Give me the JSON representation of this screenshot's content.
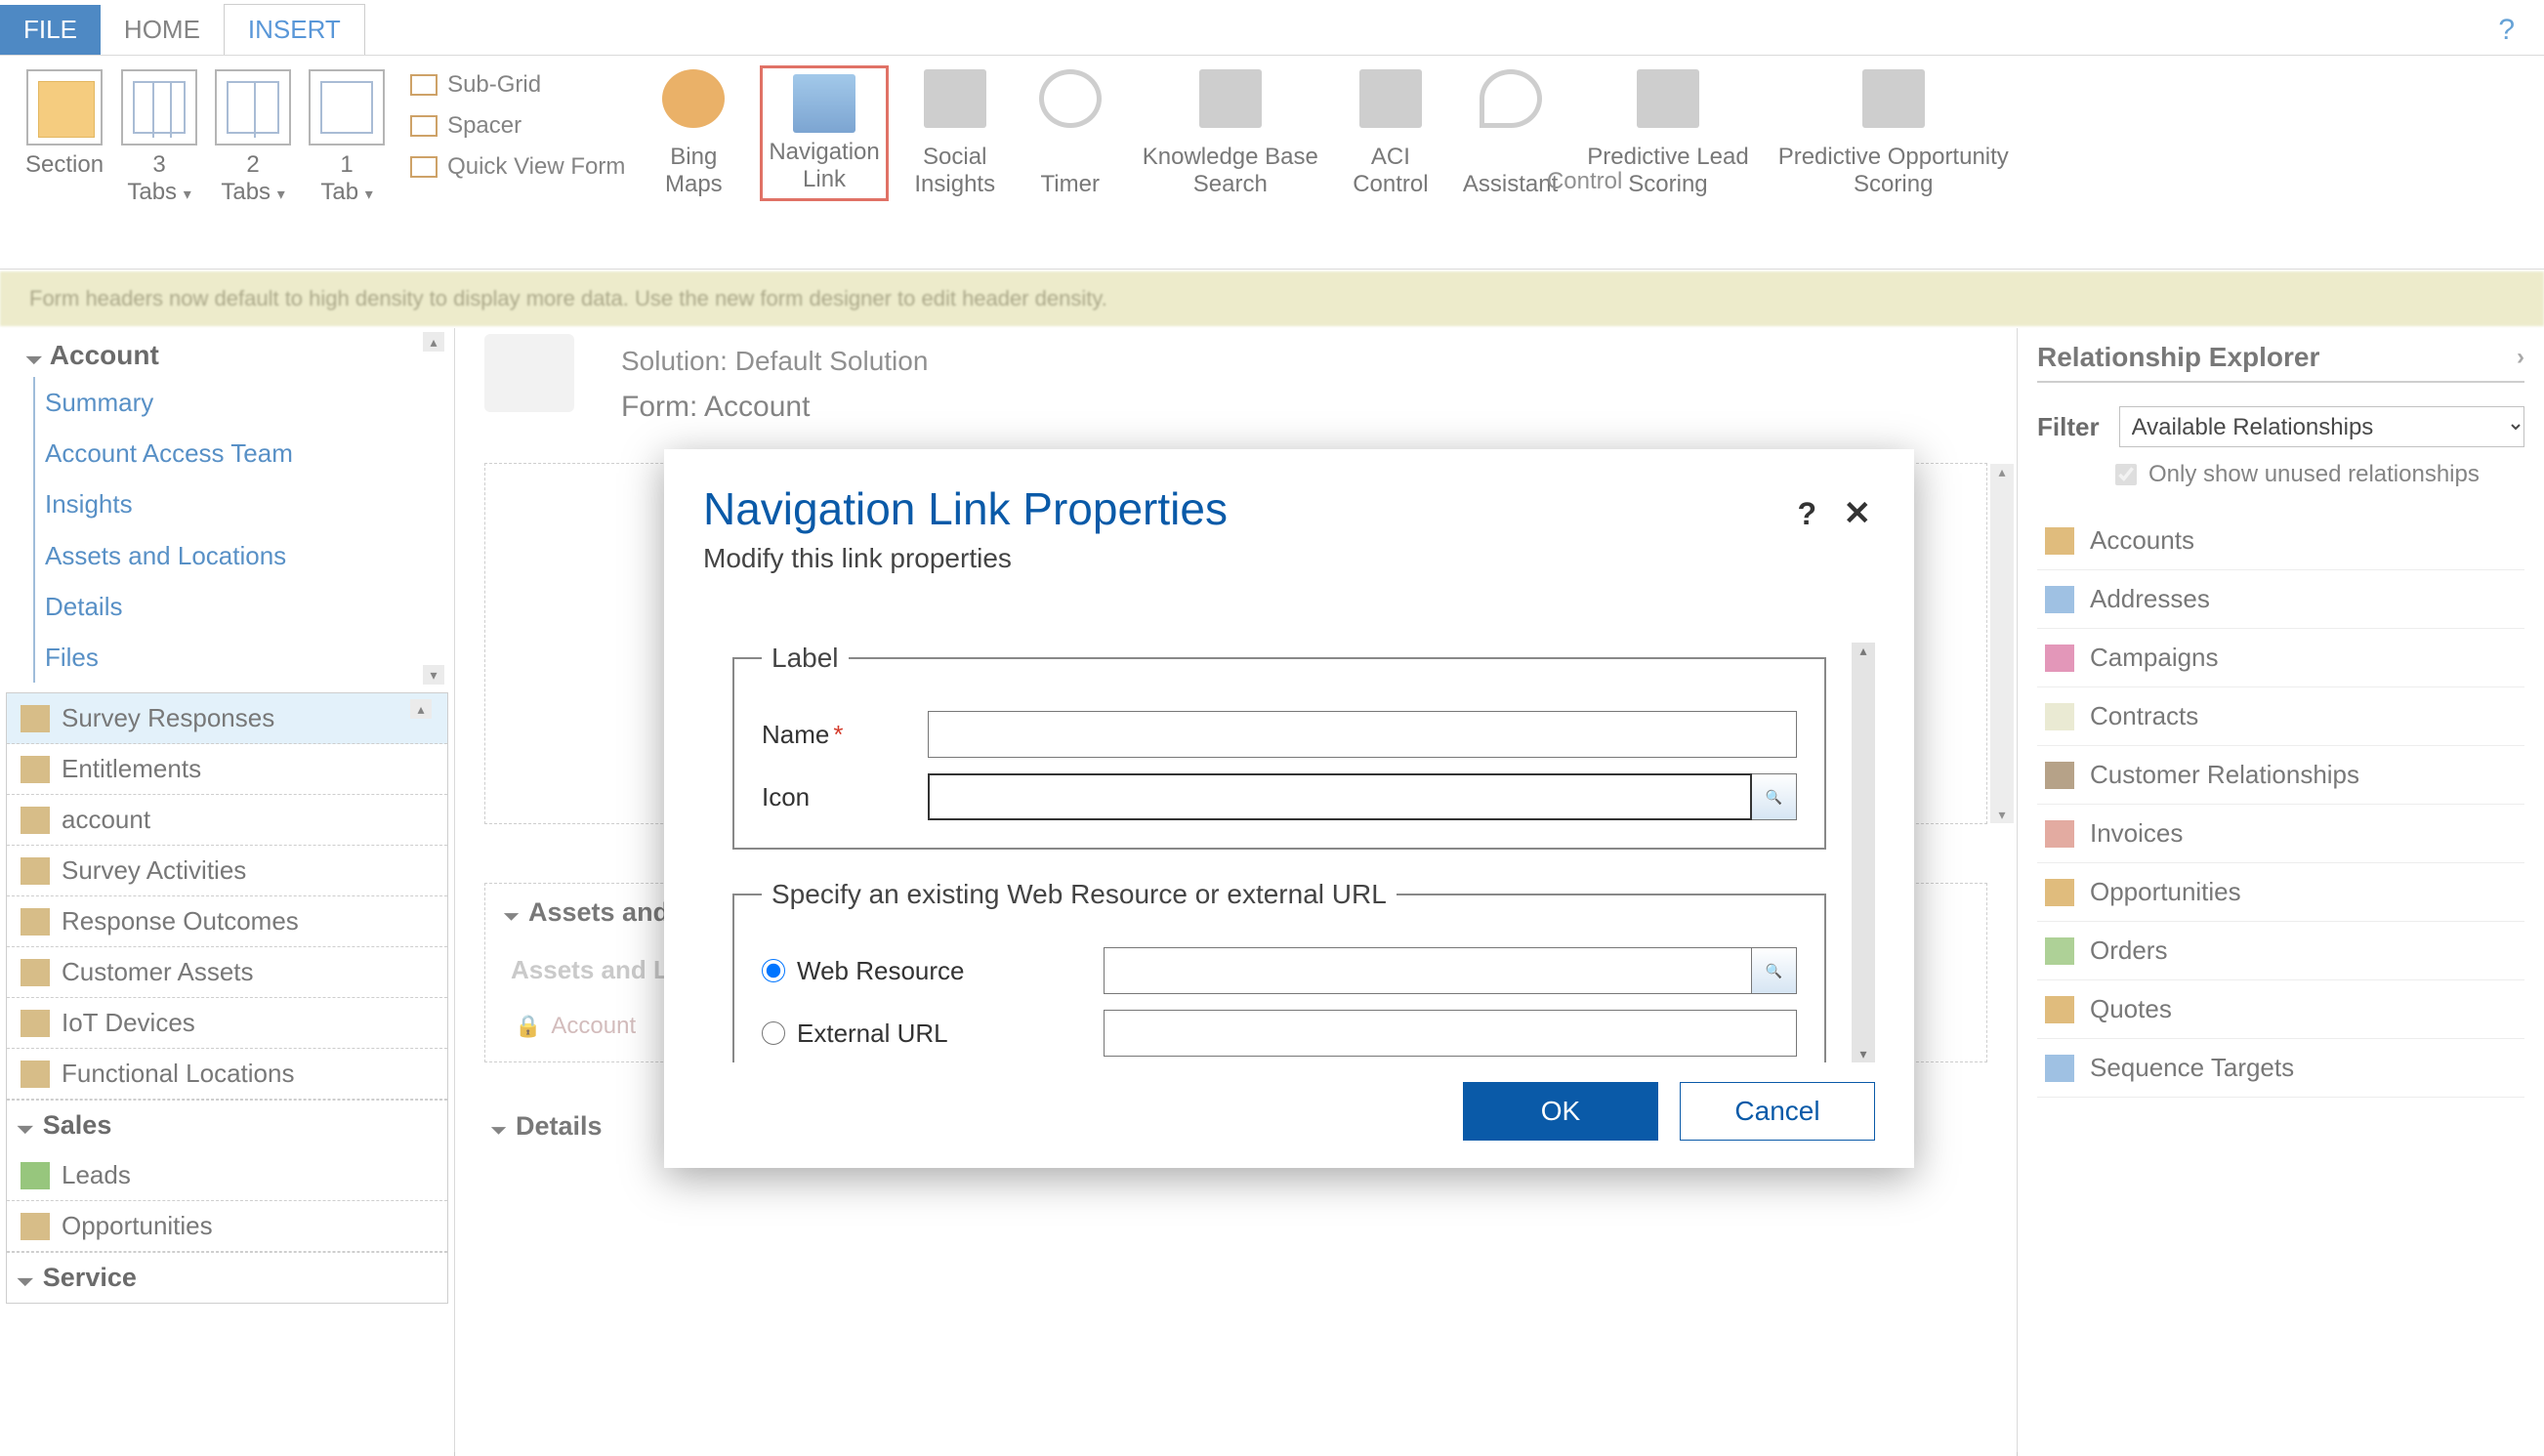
{
  "tabs": {
    "file": "FILE",
    "home": "HOME",
    "insert": "INSERT"
  },
  "ribbon": {
    "section": "Section",
    "tabs3": "3\nTabs",
    "tabs2": "2\nTabs",
    "tab1": "1\nTab",
    "subgrid": "Sub-Grid",
    "spacer": "Spacer",
    "qvf": "Quick View Form",
    "bing": "Bing\nMaps",
    "navlink": "Navigation\nLink",
    "social": "Social\nInsights",
    "timer": "Timer",
    "kbs": "Knowledge Base\nSearch",
    "aci": "ACI\nControl",
    "assistant": "Assistant",
    "pls": "Predictive Lead\nScoring",
    "pos": "Predictive Opportunity\nScoring",
    "groupLabel": "Control"
  },
  "infobar": "Form headers now default to high density to display more data. Use the new form designer to edit header density.",
  "leftnav": {
    "header": "Account",
    "links": [
      "Summary",
      "Account Access Team",
      "Insights",
      "Assets and Locations",
      "Details",
      "Files"
    ],
    "items": [
      "Survey Responses",
      "Entitlements",
      "account",
      "Survey Activities",
      "Response Outcomes",
      "Customer Assets",
      "IoT Devices",
      "Functional Locations"
    ],
    "sales": "Sales",
    "salesItems": [
      "Leads",
      "Opportunities"
    ],
    "service": "Service"
  },
  "center": {
    "solutionLabel": "Solution: Default Solution",
    "formLabel": "Form: Account",
    "assetsHeader": "Assets and Locations",
    "assetsSub": "Assets and Locations",
    "accountRow": "Account",
    "detailsHeader": "Details"
  },
  "right": {
    "title": "Relationship Explorer",
    "filterLabel": "Filter",
    "filterValue": "Available Relationships",
    "checkboxLabel": "Only show unused relationships",
    "items": [
      "Accounts",
      "Addresses",
      "Campaigns",
      "Contracts",
      "Customer Relationships",
      "Invoices",
      "Opportunities",
      "Orders",
      "Quotes",
      "Sequence Targets"
    ]
  },
  "dialog": {
    "title": "Navigation Link Properties",
    "subtitle": "Modify this link properties",
    "labelLegend": "Label",
    "nameLabel": "Name",
    "iconLabel": "Icon",
    "specLegend": "Specify an existing Web Resource or external URL",
    "webResource": "Web Resource",
    "externalUrl": "External URL",
    "ok": "OK",
    "cancel": "Cancel"
  }
}
